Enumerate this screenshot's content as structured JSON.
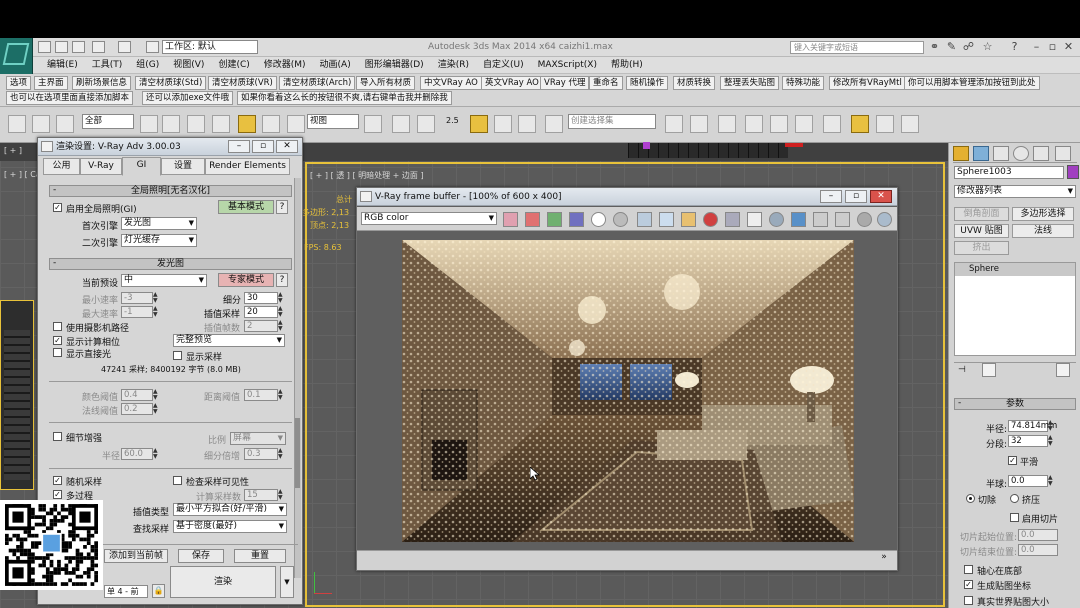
{
  "title_bar": {
    "workspace_label": "工作区: 默认",
    "app_title": "Autodesk 3ds Max  2014 x64     caizhi1.max",
    "search_placeholder": "键入关键字或短语",
    "help_symbol": "?"
  },
  "menu": [
    "编辑(E)",
    "工具(T)",
    "组(G)",
    "视图(V)",
    "创建(C)",
    "修改器(M)",
    "动画(A)",
    "图形编辑器(D)",
    "渲染(R)",
    "自定义(U)",
    "MAXScript(X)",
    "帮助(H)"
  ],
  "command_buttons_row1": [
    "选项",
    "主界面",
    "刷新场景信息",
    "清空材质球(Std)",
    "清空材质球(VR)",
    "清空材质球(Arch)",
    "导入所有材质",
    "中文VRay AO",
    "英文VRay AO",
    "VRay 代理",
    "重命名",
    "随机操作",
    "材质转换",
    "整理丢失贴图",
    "特殊功能",
    "修改所有VRayMtl",
    "你可以用脚本管理添加按钮到此处"
  ],
  "command_buttons_row2": [
    "也可以在选项里面直接添加脚本",
    "还可以添加exe文件哦",
    "如果你看着这么长的按钮很不爽,请右键单击我并删除我"
  ],
  "toolbar": {
    "filter_select": "全部",
    "view_select": "视图",
    "angle_snap": "2.5",
    "selection_set_placeholder": "创建选择集"
  },
  "viewport": {
    "label_left_top": "[ + ]",
    "label_left": "[ + ] [ Ca",
    "label_main": "[ + ] [ 透 ] [ 明暗处理 + 边面 ]",
    "stats": [
      "总计",
      "多边形: 2,13",
      "顶点: 2,13"
    ],
    "fps": "FPS: 8.63"
  },
  "render_dialog": {
    "title": "渲染设置: V-Ray Adv 3.00.03",
    "tabs": [
      "公用",
      "V-Ray",
      "GI",
      "设置",
      "Render Elements"
    ],
    "active_tab": "GI",
    "gi_section": {
      "header": "全局照明[无名汉化]",
      "enable_gi": "启用全局照明(GI)",
      "mode_button": "基本模式",
      "help": "?",
      "primary_label": "首次引擎",
      "primary_value": "发光图",
      "secondary_label": "二次引擎",
      "secondary_value": "灯光缓存"
    },
    "irradiance_section": {
      "header": "发光图",
      "preset_label": "当前预设",
      "preset_value": "中",
      "expert_button": "专家模式",
      "help": "?",
      "min_rate_label": "最小速率",
      "min_rate": "-3",
      "max_rate_label": "最大速率",
      "max_rate": "-1",
      "subdiv_label": "细分",
      "subdiv": "30",
      "interp_samples_label": "插值采样",
      "interp_samples": "20",
      "interp_frames_label": "插值帧数",
      "interp_frames": "2",
      "use_camera_path": "使用摄影机路径",
      "show_calc_phase": "显示计算相位",
      "preview_mode": "完整预览",
      "show_direct_light": "显示直接光",
      "show_samples": "显示采样",
      "sample_info": "47241 采样;  8400192 字节 (8.0 MB)",
      "color_thresh_label": "颜色阈值",
      "color_thresh": "0.4",
      "dist_thresh_label": "距离阈值",
      "dist_thresh": "0.1",
      "normal_thresh_label": "法线阈值",
      "normal_thresh": "0.2",
      "detail_enhance": "细节增强",
      "scale_label": "比例",
      "scale_value": "屏幕",
      "radius_label": "半径",
      "radius": "60.0",
      "subdiv_mult_label": "细分倍增",
      "subdiv_mult": "0.3",
      "randomize_samples": "随机采样",
      "check_visibility": "检查采样可见性",
      "multipass": "多过程",
      "calc_pass_label": "计算采样数",
      "calc_pass": "15",
      "interp_type_label": "插值类型",
      "interp_type": "最小平方拟合(好/平滑)",
      "lookup_label": "查找采样",
      "lookup_value": "基于密度(最好)"
    },
    "bottom": {
      "preset_btn": "添加到当前帧",
      "save_btn": "保存",
      "reset_btn": "重置",
      "render_btn": "渲染",
      "view_label": "单 4 - 前"
    }
  },
  "frame_buffer": {
    "title": "V-Ray frame buffer - [100% of 600 x 400]",
    "channel": "RGB color"
  },
  "command_panel": {
    "object_name": "Sphere1003",
    "modifier_list": "修改器列表",
    "buttons": [
      "倒角剖面",
      "多边形选择",
      "UVW 贴图",
      "法线",
      "挤出"
    ],
    "stack_item": "Sphere",
    "params_header": "参数",
    "radius_label": "半径:",
    "radius": "74.814mm",
    "segments_label": "分段:",
    "segments": "32",
    "smooth": "平滑",
    "hemisphere_label": "半球:",
    "hemisphere": "0.0",
    "chop": "切除",
    "squash": "挤压",
    "enable_slice": "启用切片",
    "slice_from_label": "切片起始位置:",
    "slice_from": "0.0",
    "slice_to_label": "切片结束位置:",
    "slice_to": "0.0",
    "base_to_pivot": "轴心在底部",
    "gen_mapping": "生成贴图坐标",
    "real_world": "真实世界贴图大小"
  }
}
